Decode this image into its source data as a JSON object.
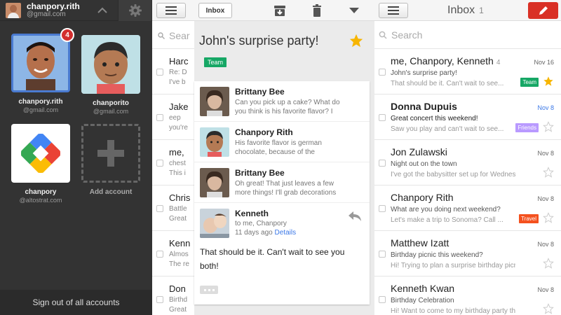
{
  "accounts_panel": {
    "current_name": "chanpory.rith",
    "current_email": "@gmail.com",
    "badge_count": "4",
    "accounts": [
      {
        "name": "chanpory.rith",
        "email": "@gmail.com"
      },
      {
        "name": "chanporito",
        "email": "@gmail.com"
      },
      {
        "name": "chanpory",
        "email": "@altostrat.com"
      }
    ],
    "add_account_label": "Add account",
    "sign_out_label": "Sign out of all accounts"
  },
  "thread_panel": {
    "back_label": "Inbox",
    "list_search_label": "Sear",
    "list_rows": [
      {
        "a": "Harc",
        "b": "Re: D",
        "c": "I've b"
      },
      {
        "a": "Jake",
        "b": "eep",
        "c": "you're"
      },
      {
        "a": "me,",
        "b": "chest",
        "c": "This i"
      },
      {
        "a": "Chris",
        "b": "Battle",
        "c": "Great"
      },
      {
        "a": "Kenn",
        "b": "Almos",
        "c": "The re"
      },
      {
        "a": "Don",
        "b": "Birthd",
        "c": "Great"
      }
    ],
    "subject": "John's surprise party!",
    "label": "Team",
    "messages": [
      {
        "from": "Brittany Bee",
        "snippet": "Can you pick up a cake? What do you think is his favorite flavor? I like"
      },
      {
        "from": "Chanpory Rith",
        "snippet": "His favorite flavor is german chocolate, because of the coconut!"
      },
      {
        "from": "Brittany Bee",
        "snippet": "Oh great! That just leaves a few more things! I'll grab decorations"
      }
    ],
    "open_message": {
      "from": "Kenneth",
      "to": "to me, Chanpory",
      "time": "11 days ago",
      "details": "Details",
      "body": "That should be it. Can't wait to see you both!"
    }
  },
  "inbox_panel": {
    "title": "Inbox",
    "count": "1",
    "search_placeholder": "Search",
    "messages": [
      {
        "sender": "me, Chanpory, Kenneth",
        "count": "4",
        "date": "Nov 16",
        "subject": "John's surprise party!",
        "preview": "That should be it. Can't wait to see...",
        "label": "Team",
        "label_color": "#16a765",
        "starred": true,
        "unread": false
      },
      {
        "sender": "Donna Dupuis",
        "count": "",
        "date": "Nov 8",
        "subject": "Great concert this weekend!",
        "preview": "Saw you play and can't wait to see...",
        "label": "Friends",
        "label_color": "#b99aff",
        "starred": false,
        "unread": true
      },
      {
        "sender": "Jon Zulawski",
        "count": "",
        "date": "Nov 8",
        "subject": "Night out on the town",
        "preview": "I've got the babysitter set up for Wednesd...",
        "label": "",
        "label_color": "",
        "starred": false,
        "unread": false
      },
      {
        "sender": "Chanpory Rith",
        "count": "",
        "date": "Nov 8",
        "subject": "What are you doing next weekend?",
        "preview": "Let's make a trip to Sonoma? Call ...",
        "label": "Travel",
        "label_color": "#f4511e",
        "starred": false,
        "unread": false
      },
      {
        "sender": "Matthew Izatt",
        "count": "",
        "date": "Nov 8",
        "subject": "Birthday picnic this weekend?",
        "preview": "Hi! Trying to plan a surprise birthday picnic...",
        "label": "",
        "label_color": "",
        "starred": false,
        "unread": false
      },
      {
        "sender": "Kenneth Kwan",
        "count": "",
        "date": "Nov 8",
        "subject": "Birthday Celebration",
        "preview": "Hi! Want to come to my birthday party this...",
        "label": "",
        "label_color": "",
        "starred": false,
        "unread": false
      }
    ]
  },
  "colors": {
    "accent": "#d93025",
    "star": "#f7b500",
    "unread_date": "#3b78e7"
  }
}
